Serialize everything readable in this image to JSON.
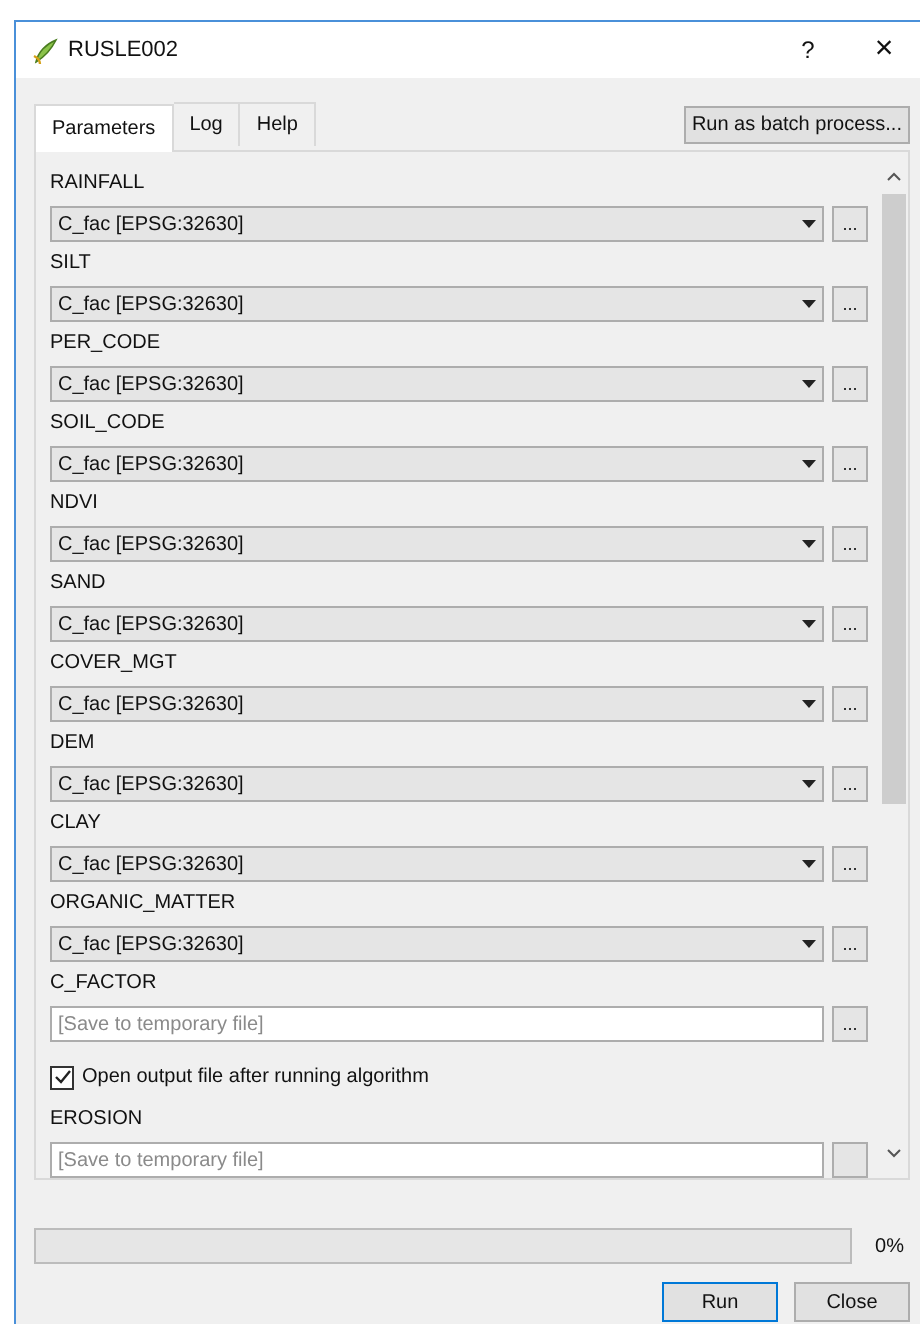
{
  "window": {
    "title": "RUSLE002",
    "help_button": "?",
    "close_button": "×"
  },
  "tabs": [
    {
      "label": "Parameters",
      "selected": true
    },
    {
      "label": "Log",
      "selected": false
    },
    {
      "label": "Help",
      "selected": false
    }
  ],
  "batch_button": "Run as batch process...",
  "parameters": [
    {
      "kind": "layer",
      "label": "RAINFALL",
      "value": "C_fac [EPSG:32630]",
      "browse": "..."
    },
    {
      "kind": "layer",
      "label": "SILT",
      "value": "C_fac [EPSG:32630]",
      "browse": "..."
    },
    {
      "kind": "layer",
      "label": "PER_CODE",
      "value": "C_fac [EPSG:32630]",
      "browse": "..."
    },
    {
      "kind": "layer",
      "label": "SOIL_CODE",
      "value": "C_fac [EPSG:32630]",
      "browse": "..."
    },
    {
      "kind": "layer",
      "label": "NDVI",
      "value": "C_fac [EPSG:32630]",
      "browse": "..."
    },
    {
      "kind": "layer",
      "label": "SAND",
      "value": "C_fac [EPSG:32630]",
      "browse": "..."
    },
    {
      "kind": "layer",
      "label": "COVER_MGT",
      "value": "C_fac [EPSG:32630]",
      "browse": "..."
    },
    {
      "kind": "layer",
      "label": "DEM",
      "value": "C_fac [EPSG:32630]",
      "browse": "..."
    },
    {
      "kind": "layer",
      "label": "CLAY",
      "value": "C_fac [EPSG:32630]",
      "browse": "..."
    },
    {
      "kind": "layer",
      "label": "ORGANIC_MATTER",
      "value": "C_fac [EPSG:32630]",
      "browse": "..."
    },
    {
      "kind": "output",
      "label": "C_FACTOR",
      "placeholder": "[Save to temporary file]",
      "browse": "..."
    },
    {
      "kind": "checkbox",
      "label": "Open output file after running algorithm",
      "checked": true
    },
    {
      "kind": "output",
      "label": "EROSION",
      "placeholder": "[Save to temporary file]"
    }
  ],
  "progress": {
    "level": 0,
    "reading": "0%"
  },
  "buttons": [
    {
      "label": "Run",
      "selected": true
    },
    {
      "label": "Close",
      "selected": false
    }
  ]
}
